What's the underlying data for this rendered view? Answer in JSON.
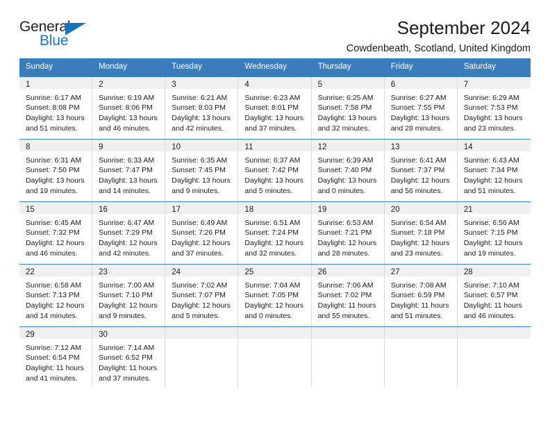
{
  "logo": {
    "word_top": "General",
    "word_bottom": "Blue",
    "triangle_color": "#1b74bb",
    "text_color": "#231f20"
  },
  "header": {
    "title": "September 2024",
    "subtitle": "Cowdenbeath, Scotland, United Kingdom"
  },
  "theme": {
    "header_bg": "#3a7dbf",
    "header_text": "#ffffff",
    "daynum_band_bg": "#f0f0f0",
    "cell_border": "#d9d9d9",
    "week_divider": "#3a7dbf"
  },
  "weekdays": [
    "Sunday",
    "Monday",
    "Tuesday",
    "Wednesday",
    "Thursday",
    "Friday",
    "Saturday"
  ],
  "weeks": [
    [
      {
        "day": "1",
        "line1": "Sunrise: 6:17 AM",
        "line2": "Sunset: 8:08 PM",
        "line3": "Daylight: 13 hours",
        "line4": "and 51 minutes."
      },
      {
        "day": "2",
        "line1": "Sunrise: 6:19 AM",
        "line2": "Sunset: 8:06 PM",
        "line3": "Daylight: 13 hours",
        "line4": "and 46 minutes."
      },
      {
        "day": "3",
        "line1": "Sunrise: 6:21 AM",
        "line2": "Sunset: 8:03 PM",
        "line3": "Daylight: 13 hours",
        "line4": "and 42 minutes."
      },
      {
        "day": "4",
        "line1": "Sunrise: 6:23 AM",
        "line2": "Sunset: 8:01 PM",
        "line3": "Daylight: 13 hours",
        "line4": "and 37 minutes."
      },
      {
        "day": "5",
        "line1": "Sunrise: 6:25 AM",
        "line2": "Sunset: 7:58 PM",
        "line3": "Daylight: 13 hours",
        "line4": "and 32 minutes."
      },
      {
        "day": "6",
        "line1": "Sunrise: 6:27 AM",
        "line2": "Sunset: 7:55 PM",
        "line3": "Daylight: 13 hours",
        "line4": "and 28 minutes."
      },
      {
        "day": "7",
        "line1": "Sunrise: 6:29 AM",
        "line2": "Sunset: 7:53 PM",
        "line3": "Daylight: 13 hours",
        "line4": "and 23 minutes."
      }
    ],
    [
      {
        "day": "8",
        "line1": "Sunrise: 6:31 AM",
        "line2": "Sunset: 7:50 PM",
        "line3": "Daylight: 13 hours",
        "line4": "and 19 minutes."
      },
      {
        "day": "9",
        "line1": "Sunrise: 6:33 AM",
        "line2": "Sunset: 7:47 PM",
        "line3": "Daylight: 13 hours",
        "line4": "and 14 minutes."
      },
      {
        "day": "10",
        "line1": "Sunrise: 6:35 AM",
        "line2": "Sunset: 7:45 PM",
        "line3": "Daylight: 13 hours",
        "line4": "and 9 minutes."
      },
      {
        "day": "11",
        "line1": "Sunrise: 6:37 AM",
        "line2": "Sunset: 7:42 PM",
        "line3": "Daylight: 13 hours",
        "line4": "and 5 minutes."
      },
      {
        "day": "12",
        "line1": "Sunrise: 6:39 AM",
        "line2": "Sunset: 7:40 PM",
        "line3": "Daylight: 13 hours",
        "line4": "and 0 minutes."
      },
      {
        "day": "13",
        "line1": "Sunrise: 6:41 AM",
        "line2": "Sunset: 7:37 PM",
        "line3": "Daylight: 12 hours",
        "line4": "and 56 minutes."
      },
      {
        "day": "14",
        "line1": "Sunrise: 6:43 AM",
        "line2": "Sunset: 7:34 PM",
        "line3": "Daylight: 12 hours",
        "line4": "and 51 minutes."
      }
    ],
    [
      {
        "day": "15",
        "line1": "Sunrise: 6:45 AM",
        "line2": "Sunset: 7:32 PM",
        "line3": "Daylight: 12 hours",
        "line4": "and 46 minutes."
      },
      {
        "day": "16",
        "line1": "Sunrise: 6:47 AM",
        "line2": "Sunset: 7:29 PM",
        "line3": "Daylight: 12 hours",
        "line4": "and 42 minutes."
      },
      {
        "day": "17",
        "line1": "Sunrise: 6:49 AM",
        "line2": "Sunset: 7:26 PM",
        "line3": "Daylight: 12 hours",
        "line4": "and 37 minutes."
      },
      {
        "day": "18",
        "line1": "Sunrise: 6:51 AM",
        "line2": "Sunset: 7:24 PM",
        "line3": "Daylight: 12 hours",
        "line4": "and 32 minutes."
      },
      {
        "day": "19",
        "line1": "Sunrise: 6:53 AM",
        "line2": "Sunset: 7:21 PM",
        "line3": "Daylight: 12 hours",
        "line4": "and 28 minutes."
      },
      {
        "day": "20",
        "line1": "Sunrise: 6:54 AM",
        "line2": "Sunset: 7:18 PM",
        "line3": "Daylight: 12 hours",
        "line4": "and 23 minutes."
      },
      {
        "day": "21",
        "line1": "Sunrise: 6:56 AM",
        "line2": "Sunset: 7:15 PM",
        "line3": "Daylight: 12 hours",
        "line4": "and 19 minutes."
      }
    ],
    [
      {
        "day": "22",
        "line1": "Sunrise: 6:58 AM",
        "line2": "Sunset: 7:13 PM",
        "line3": "Daylight: 12 hours",
        "line4": "and 14 minutes."
      },
      {
        "day": "23",
        "line1": "Sunrise: 7:00 AM",
        "line2": "Sunset: 7:10 PM",
        "line3": "Daylight: 12 hours",
        "line4": "and 9 minutes."
      },
      {
        "day": "24",
        "line1": "Sunrise: 7:02 AM",
        "line2": "Sunset: 7:07 PM",
        "line3": "Daylight: 12 hours",
        "line4": "and 5 minutes."
      },
      {
        "day": "25",
        "line1": "Sunrise: 7:04 AM",
        "line2": "Sunset: 7:05 PM",
        "line3": "Daylight: 12 hours",
        "line4": "and 0 minutes."
      },
      {
        "day": "26",
        "line1": "Sunrise: 7:06 AM",
        "line2": "Sunset: 7:02 PM",
        "line3": "Daylight: 11 hours",
        "line4": "and 55 minutes."
      },
      {
        "day": "27",
        "line1": "Sunrise: 7:08 AM",
        "line2": "Sunset: 6:59 PM",
        "line3": "Daylight: 11 hours",
        "line4": "and 51 minutes."
      },
      {
        "day": "28",
        "line1": "Sunrise: 7:10 AM",
        "line2": "Sunset: 6:57 PM",
        "line3": "Daylight: 11 hours",
        "line4": "and 46 minutes."
      }
    ],
    [
      {
        "day": "29",
        "line1": "Sunrise: 7:12 AM",
        "line2": "Sunset: 6:54 PM",
        "line3": "Daylight: 11 hours",
        "line4": "and 41 minutes."
      },
      {
        "day": "30",
        "line1": "Sunrise: 7:14 AM",
        "line2": "Sunset: 6:52 PM",
        "line3": "Daylight: 11 hours",
        "line4": "and 37 minutes."
      },
      {
        "day": "",
        "line1": "",
        "line2": "",
        "line3": "",
        "line4": ""
      },
      {
        "day": "",
        "line1": "",
        "line2": "",
        "line3": "",
        "line4": ""
      },
      {
        "day": "",
        "line1": "",
        "line2": "",
        "line3": "",
        "line4": ""
      },
      {
        "day": "",
        "line1": "",
        "line2": "",
        "line3": "",
        "line4": ""
      },
      {
        "day": "",
        "line1": "",
        "line2": "",
        "line3": "",
        "line4": ""
      }
    ]
  ]
}
